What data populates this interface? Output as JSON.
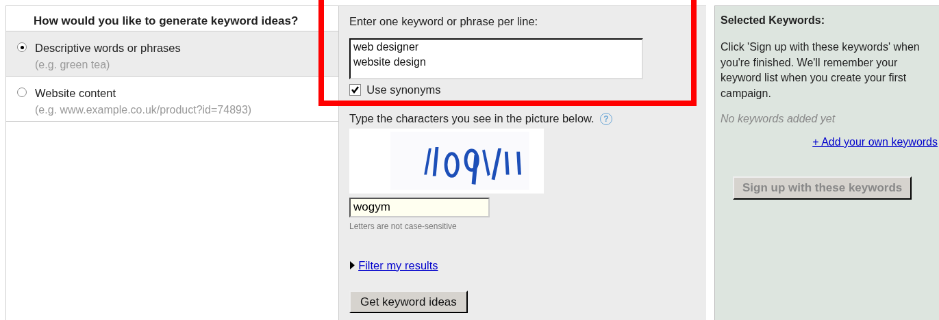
{
  "method_panel": {
    "heading": "How would you like to generate keyword ideas?",
    "options": [
      {
        "label": "Descriptive words or phrases",
        "example": "(e.g. green tea)",
        "selected": true
      },
      {
        "label": "Website content",
        "example": "(e.g. www.example.co.uk/product?id=74893)",
        "selected": false
      }
    ]
  },
  "input_panel": {
    "prompt": "Enter one keyword or phrase per line:",
    "keywords": "web designer\nwebsite design",
    "synonyms": {
      "label": "Use synonyms",
      "checked": true
    },
    "captcha_prompt": "Type the characters you see in the picture below.",
    "help": "?",
    "captcha_value": "wogym",
    "captcha_hint": "Letters are not case-sensitive",
    "filter_link": {
      "label": "Filter my results",
      "expanded": false
    },
    "submit": "Get keyword ideas"
  },
  "selected_panel": {
    "heading": "Selected Keywords:",
    "text": "Click 'Sign up with these keywords' when you're finished. We'll remember your keyword list when you create your first campaign.",
    "empty": "No keywords added yet",
    "add_link": "+ Add your own keywords",
    "signup": {
      "label": "Sign up with these keywords",
      "disabled": true
    }
  },
  "highlight_frame": true
}
